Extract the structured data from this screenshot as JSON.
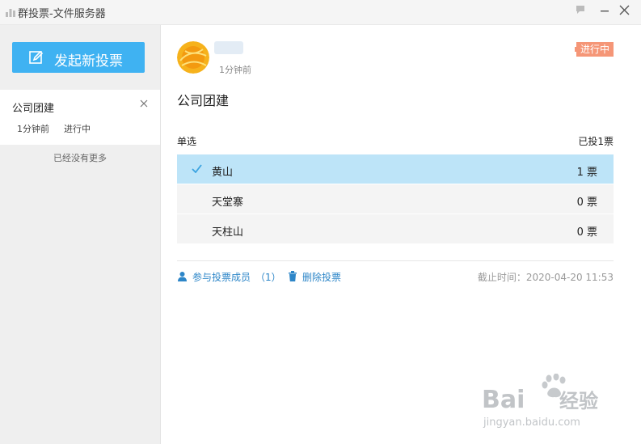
{
  "window": {
    "title": "群投票-文件服务器"
  },
  "sidebar": {
    "new_vote_label": "发起新投票",
    "votes": [
      {
        "title": "公司团建",
        "time": "1分钟前",
        "status": "进行中"
      }
    ],
    "no_more_text": "已经没有更多"
  },
  "detail": {
    "post_time": "1分钟前",
    "status_badge": "进行中",
    "title": "公司团建",
    "vote_type": "单选",
    "vote_count": "已投1票",
    "options": [
      {
        "label": "黄山",
        "votes": "1 票",
        "selected": true
      },
      {
        "label": "天堂寨",
        "votes": "0 票",
        "selected": false
      },
      {
        "label": "天柱山",
        "votes": "0 票",
        "selected": false
      }
    ],
    "participants_label": "参与投票成员",
    "participants_count": "（1）",
    "delete_label": "删除投票",
    "deadline": "截止时间：2020-04-20 11:53"
  },
  "colors": {
    "accent": "#3fb2f2",
    "badge": "#f59677",
    "selected_row": "#bde4f8",
    "link": "#2d86c8"
  },
  "icons": [
    "app-icon",
    "feedback-icon",
    "minimize-icon",
    "close-icon",
    "edit-icon",
    "check-icon",
    "user-icon",
    "trash-icon"
  ]
}
